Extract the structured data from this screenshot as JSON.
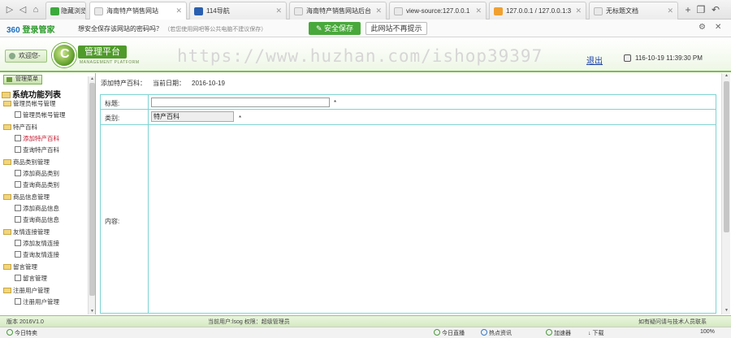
{
  "browser": {
    "tabs": [
      {
        "label": "隐藏浏览",
        "active": false
      },
      {
        "label": "海南特产销售网站",
        "active": true
      },
      {
        "label": "114导航",
        "active": false
      },
      {
        "label": "海南特产销售网站后台",
        "active": false
      },
      {
        "label": "view-source:127.0.0.1",
        "active": false
      },
      {
        "label": "127.0.0.1 / 127.0.0.1:3",
        "active": false
      },
      {
        "label": "无标题文档",
        "active": false
      }
    ]
  },
  "password_bar": {
    "brand": "360",
    "brand_suffix": "登录管家",
    "question": "想安全保存该网站的密码吗？",
    "hint": "（若您使用网吧等公共电脑不建议保存）",
    "save_label": "安全保存",
    "never_label": "此网站不再提示"
  },
  "header": {
    "welcome": "欢迎您-",
    "brand_title": "管理平台",
    "brand_sub": "MANAGEMENT PLATFORM",
    "watermark": "https://www.huzhan.com/ishop39397",
    "logout": "退出",
    "datetime": "116-10-19 11:39:30 PM"
  },
  "sidebar": {
    "tab_label": "管理菜单",
    "root": "系统功能列表",
    "groups": [
      {
        "label": "管理员帐号管理",
        "items": [
          "管理员帐号管理"
        ]
      },
      {
        "label": "特产百科",
        "items": [
          "添加特产百科",
          "查询特产百科"
        ]
      },
      {
        "label": "商品类别管理",
        "items": [
          "添加商品类别",
          "查询商品类别"
        ]
      },
      {
        "label": "商品信息管理",
        "items": [
          "添加商品信息",
          "查询商品信息"
        ]
      },
      {
        "label": "友情连接管理",
        "items": [
          "添加友情连接",
          "查询友情连接"
        ]
      },
      {
        "label": "留言管理",
        "items": [
          "留言管理"
        ]
      },
      {
        "label": "注册用户管理",
        "items": [
          "注册用户管理"
        ]
      }
    ]
  },
  "main": {
    "page_title": "添加特产百科：",
    "date_label": "当前日期：",
    "date_value": "2016-10-19",
    "form": {
      "title_label": "标题:",
      "title_value": "",
      "required_mark": "*",
      "category_label": "类别:",
      "category_value": "特产百科",
      "content_label": "内容:"
    }
  },
  "footer": {
    "version": "版本 2016V1.0",
    "user_text": "当前用户:lsog  权限：超级管理员",
    "right_text": "如有疑问请与技术人员联系"
  },
  "statusbar": {
    "left": "今日特卖",
    "items": [
      "今日直播",
      "热点资讯",
      "加速器",
      "下载"
    ],
    "zoom": "100%"
  }
}
